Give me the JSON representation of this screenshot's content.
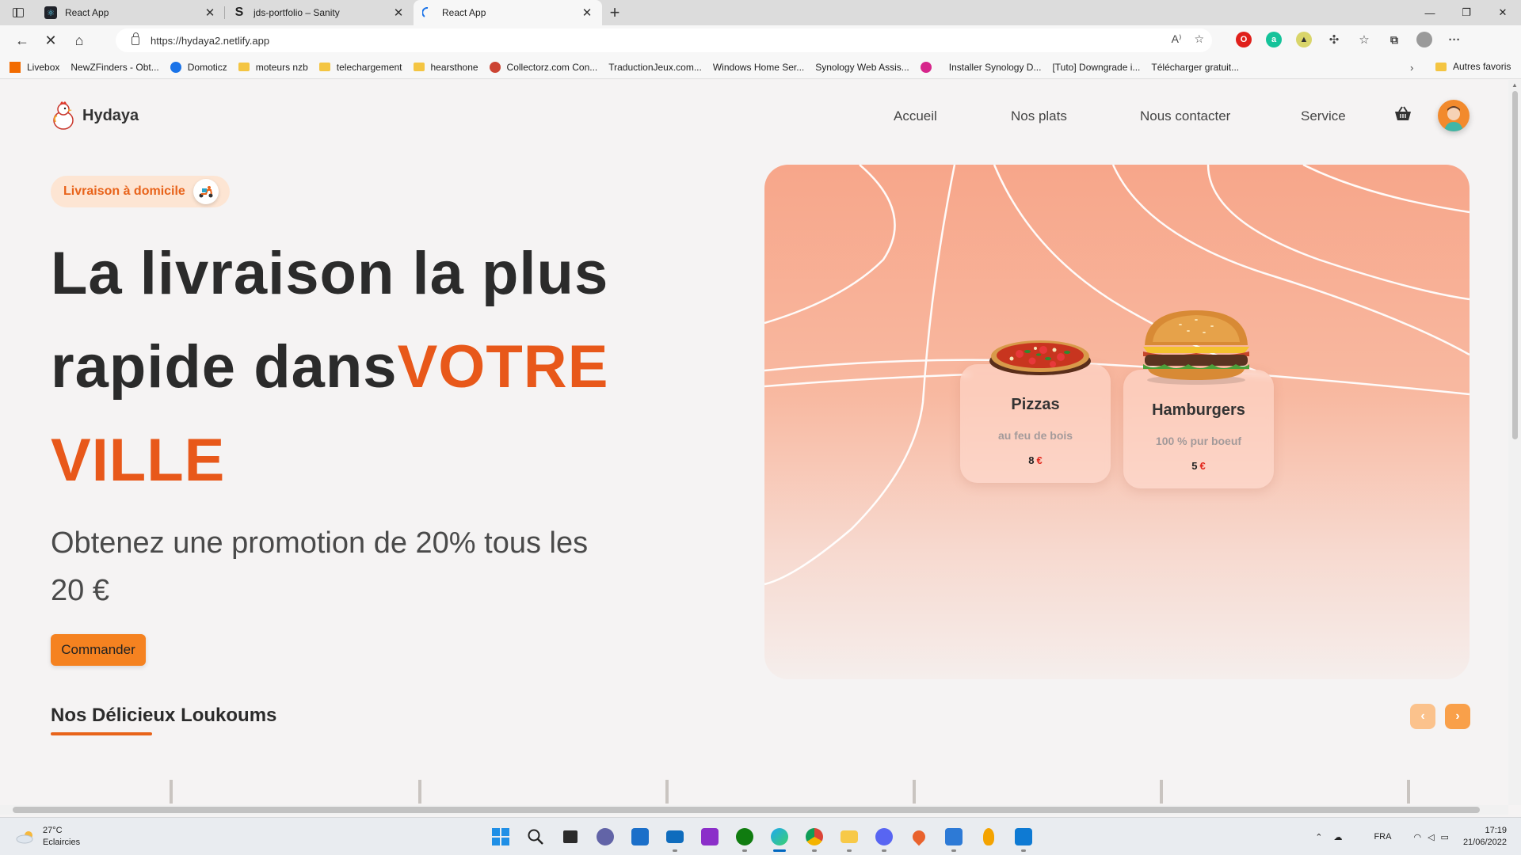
{
  "browser": {
    "tabs": [
      {
        "title": "React App",
        "favicon": "react-icon"
      },
      {
        "title": "jds-portfolio – Sanity",
        "favicon": "sanity-s-icon"
      },
      {
        "title": "React App",
        "favicon": "loading-icon",
        "active": true
      }
    ],
    "url": "https://hydaya2.netlify.app",
    "bookmarks": [
      {
        "label": "Livebox",
        "icon": "orange-square-icon"
      },
      {
        "label": "NewZFinders - Obt...",
        "icon": "page-icon"
      },
      {
        "label": "Domoticz",
        "icon": "domoticz-icon"
      },
      {
        "label": "moteurs nzb",
        "icon": "folder-icon"
      },
      {
        "label": "telechargement",
        "icon": "folder-icon"
      },
      {
        "label": "hearsthone",
        "icon": "folder-icon"
      },
      {
        "label": "Collectorz.com Con...",
        "icon": "collectorz-icon"
      },
      {
        "label": "TraductionJeux.com...",
        "icon": "page-icon"
      },
      {
        "label": "Windows Home Ser...",
        "icon": "page-icon"
      },
      {
        "label": "Synology Web Assis...",
        "icon": "page-icon"
      },
      {
        "label": "",
        "icon": "pink-circle-icon"
      },
      {
        "label": "Installer Synology D...",
        "icon": "page-icon"
      },
      {
        "label": "[Tuto] Downgrade i...",
        "icon": "page-icon"
      },
      {
        "label": "Télécharger gratuit...",
        "icon": "page-icon"
      }
    ],
    "other_favorites": "Autres favoris"
  },
  "site": {
    "brand": "Hydaya",
    "nav": [
      "Accueil",
      "Nos plats",
      "Nous contacter",
      "Service"
    ],
    "pill": "Livraison à domicile",
    "hero": {
      "line1": "La livraison la plus",
      "line2a": "rapide dans",
      "line2b": "VOTRE",
      "line3": "VILLE"
    },
    "subtitle": "Obtenez une promotion de 20% tous les 20 €",
    "cta": "Commander",
    "cards": [
      {
        "name": "Pizzas",
        "desc": "au feu de bois",
        "price": "8",
        "currency": "€"
      },
      {
        "name": "Hamburgers",
        "desc": "100 % pur boeuf",
        "price": "5",
        "currency": "€"
      }
    ],
    "section_title": "Nos Délicieux Loukoums",
    "carousel_prev": "‹",
    "carousel_next": "›"
  },
  "taskbar": {
    "temperature": "27°C",
    "weather": "Eclaircies",
    "language": "FRA",
    "time": "17:19",
    "date": "21/06/2022"
  },
  "colors": {
    "accent": "#e8581a",
    "button": "#f58220",
    "panel_top": "#f7a68a"
  }
}
